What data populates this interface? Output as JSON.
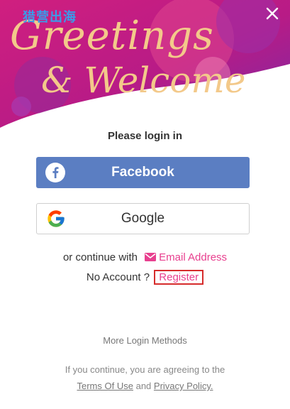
{
  "brand": "猎营出海",
  "hero": {
    "line1": "Greetings",
    "line2": "& Welcome"
  },
  "login_title": "Please login in",
  "buttons": {
    "facebook": "Facebook",
    "google": "Google"
  },
  "continue": {
    "prefix": "or continue with",
    "email_label": "Email Address",
    "no_account": "No Account ?",
    "register_label": "Register"
  },
  "more_methods": "More Login Methods",
  "terms": {
    "text": "If you continue, you are agreeing to the",
    "terms_link": "Terms Of Use",
    "and": "and",
    "privacy_link": "Privacy Policy."
  },
  "colors": {
    "facebook_blue": "#5b7ec2",
    "accent_pink": "#e8408f",
    "hero_magenta": "#c21f85",
    "hero_gold": "#f3c98a",
    "register_highlight": "#d62c2c"
  },
  "icons": [
    "close-icon",
    "facebook-icon",
    "google-icon",
    "email-icon"
  ]
}
